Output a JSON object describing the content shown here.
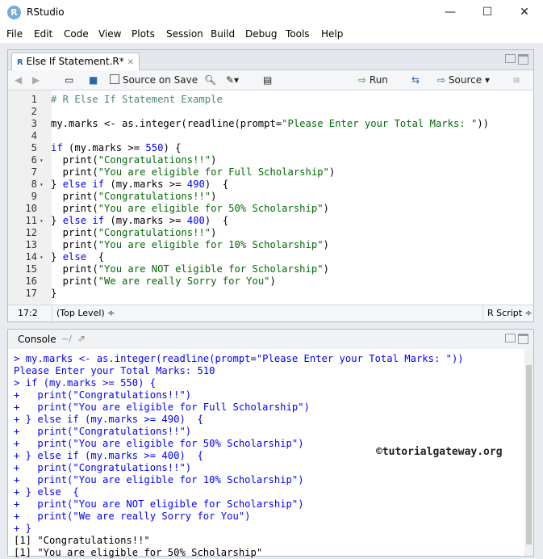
{
  "window": {
    "title": "RStudio",
    "icon": "R",
    "minimize": "—",
    "maximize": "☐",
    "close": "✕"
  },
  "menu": [
    "File",
    "Edit",
    "Code",
    "View",
    "Plots",
    "Session",
    "Build",
    "Debug",
    "Tools",
    "Help"
  ],
  "source": {
    "tab_label": "Else If Statement.R*",
    "toolbar": {
      "source_on_save": "Source on Save",
      "run": "Run",
      "source": "Source"
    },
    "lines": [
      {
        "n": "1",
        "fold": "",
        "html": "<span class=\"cmt\"># R Else If Statement Example</span>"
      },
      {
        "n": "2",
        "fold": "",
        "html": ""
      },
      {
        "n": "3",
        "fold": "",
        "html": "my.marks &lt;- as.integer(readline(prompt=<span class=\"str\">\"Please Enter your Total Marks: \"</span>))"
      },
      {
        "n": "4",
        "fold": "",
        "html": ""
      },
      {
        "n": "5",
        "fold": "",
        "html": "<span class=\"kw\">if</span> (my.marks &gt;= <span class=\"num\">550</span>) {"
      },
      {
        "n": "6",
        "fold": "▾",
        "html": "  print(<span class=\"str\">\"Congratulations!!\"</span>)"
      },
      {
        "n": "7",
        "fold": "",
        "html": "  print(<span class=\"str\">\"You are eligible for Full Scholarship\"</span>)"
      },
      {
        "n": "8",
        "fold": "▾",
        "html": "} <span class=\"kw\">else if</span> (my.marks &gt;= <span class=\"num\">490</span>)  {"
      },
      {
        "n": "9",
        "fold": "",
        "html": "  print(<span class=\"str\">\"Congratulations!!\"</span>)"
      },
      {
        "n": "10",
        "fold": "",
        "html": "  print(<span class=\"str\">\"You are eligible for 50% Scholarship\"</span>)"
      },
      {
        "n": "11",
        "fold": "▾",
        "html": "} <span class=\"kw\">else if</span> (my.marks &gt;= <span class=\"num\">400</span>)  {"
      },
      {
        "n": "12",
        "fold": "",
        "html": "  print(<span class=\"str\">\"Congratulations!!\"</span>)"
      },
      {
        "n": "13",
        "fold": "",
        "html": "  print(<span class=\"str\">\"You are eligible for 10% Scholarship\"</span>)"
      },
      {
        "n": "14",
        "fold": "▾",
        "html": "} <span class=\"kw\">else</span>  {"
      },
      {
        "n": "15",
        "fold": "",
        "html": "  print(<span class=\"str\">\"You are NOT eligible for Scholarship\"</span>)"
      },
      {
        "n": "16",
        "fold": "",
        "html": "  print(<span class=\"str\">\"We are really Sorry for You\"</span>)"
      },
      {
        "n": "17",
        "fold": "",
        "html": "}"
      }
    ],
    "status": {
      "position": "17:2",
      "scope": "(Top Level) ÷",
      "filetype": "R Script ÷"
    }
  },
  "console": {
    "tab_label": "Console",
    "path": "~/",
    "watermark": "©tutorialgateway.org",
    "lines": [
      {
        "cls": "",
        "text": "> my.marks <- as.integer(readline(prompt=\"Please Enter your Total Marks: \"))"
      },
      {
        "cls": "",
        "text": "Please Enter your Total Marks: 510"
      },
      {
        "cls": "",
        "text": "> if (my.marks >= 550) {"
      },
      {
        "cls": "",
        "text": "+   print(\"Congratulations!!\")"
      },
      {
        "cls": "",
        "text": "+   print(\"You are eligible for Full Scholarship\")"
      },
      {
        "cls": "",
        "text": "+ } else if (my.marks >= 490)  {"
      },
      {
        "cls": "",
        "text": "+   print(\"Congratulations!!\")"
      },
      {
        "cls": "",
        "text": "+   print(\"You are eligible for 50% Scholarship\")"
      },
      {
        "cls": "",
        "text": "+ } else if (my.marks >= 400)  {"
      },
      {
        "cls": "",
        "text": "+   print(\"Congratulations!!\")"
      },
      {
        "cls": "",
        "text": "+   print(\"You are eligible for 10% Scholarship\")"
      },
      {
        "cls": "",
        "text": "+ } else  {"
      },
      {
        "cls": "",
        "text": "+   print(\"You are NOT eligible for Scholarship\")"
      },
      {
        "cls": "",
        "text": "+   print(\"We are really Sorry for You\")"
      },
      {
        "cls": "",
        "text": "+ }"
      },
      {
        "cls": "out",
        "text": "[1] \"Congratulations!!\""
      },
      {
        "cls": "out",
        "text": "[1] \"You are eligible for 50% Scholarship\""
      }
    ]
  }
}
